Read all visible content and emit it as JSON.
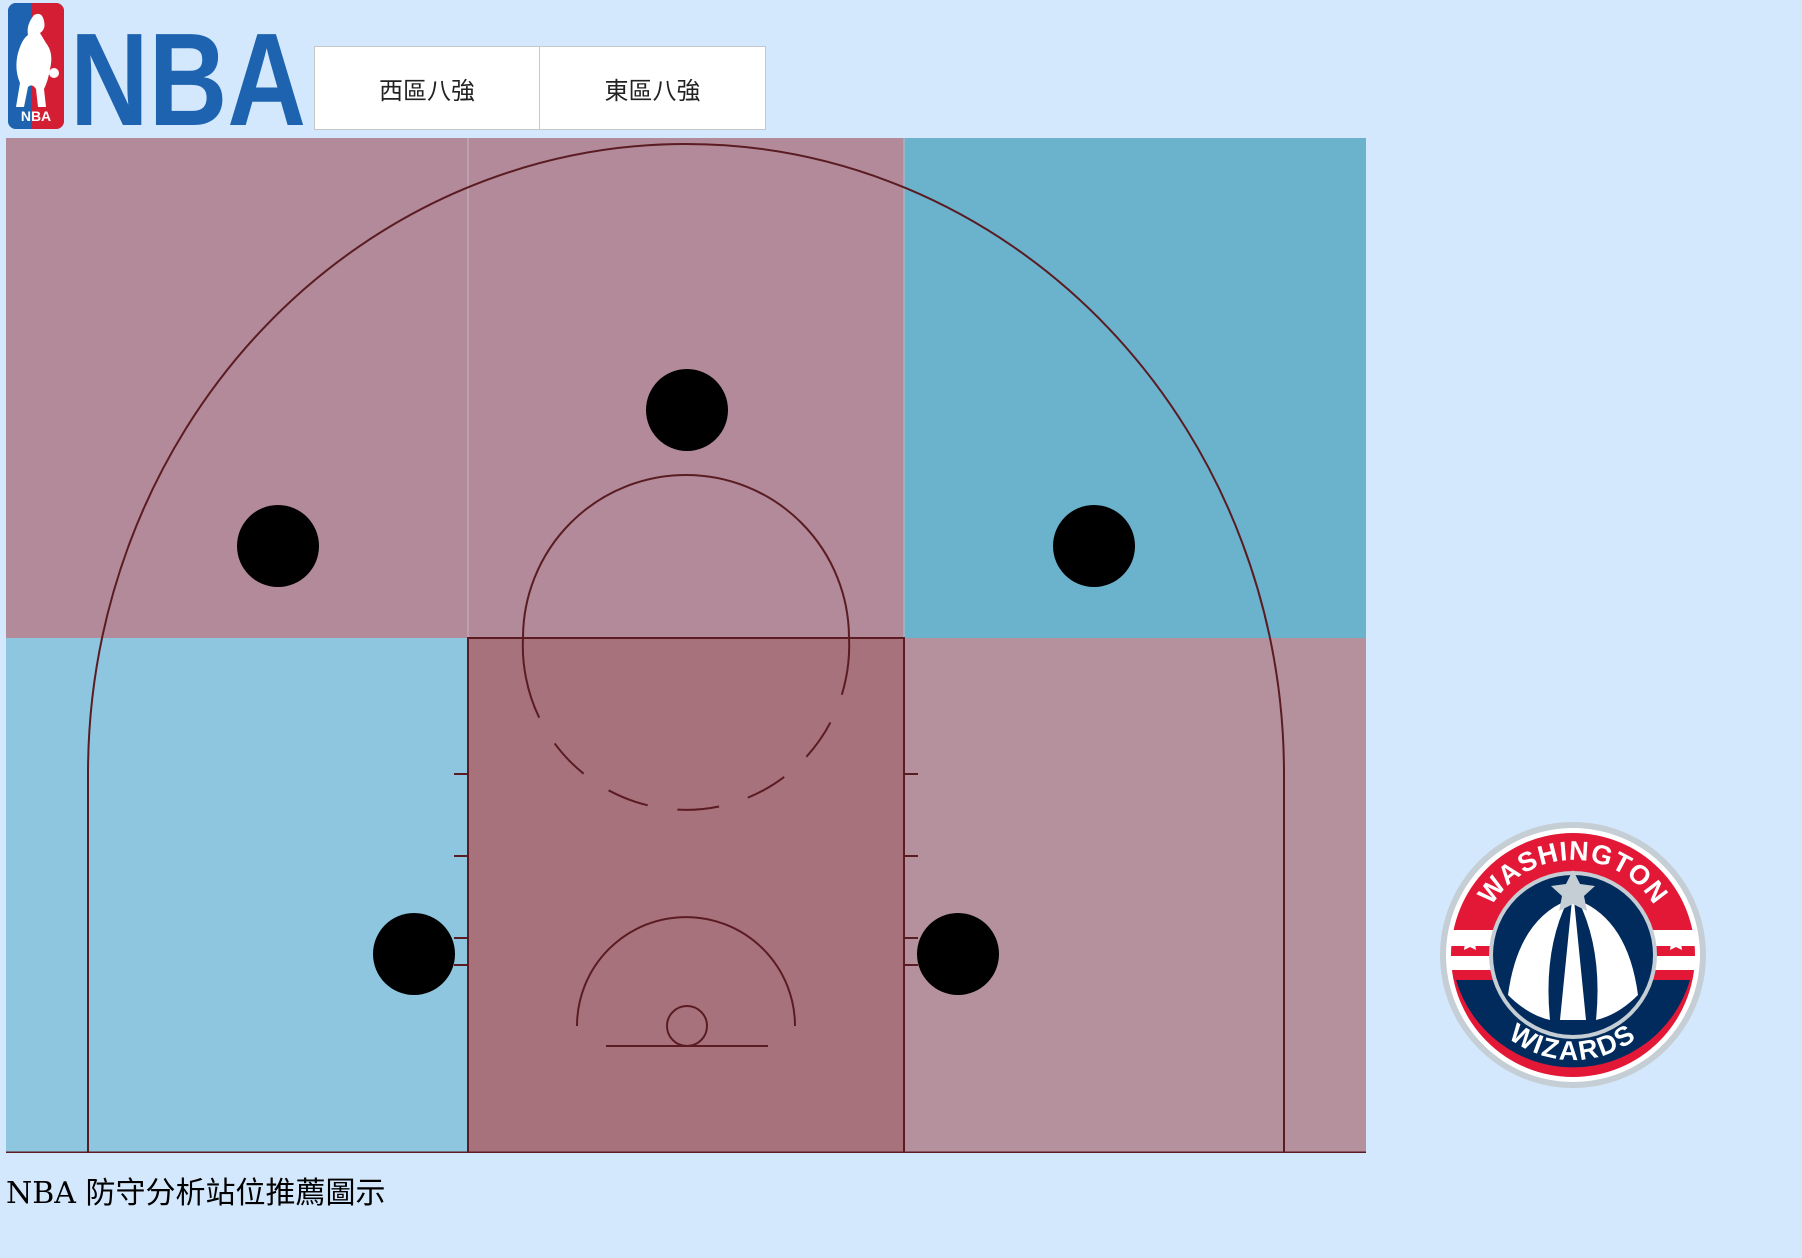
{
  "header": {
    "logo": {
      "icon": "nba-logo-icon",
      "text": "NBA",
      "badge_text": "NBA"
    },
    "tabs": [
      {
        "label": "西區八強"
      },
      {
        "label": "東區八強"
      }
    ]
  },
  "court": {
    "zones": [
      {
        "id": "left-wing",
        "color": "#b28a99"
      },
      {
        "id": "top",
        "color": "#b28a99"
      },
      {
        "id": "right-wing",
        "color": "#6bb3cd"
      },
      {
        "id": "left-corner",
        "color": "#8ec5df"
      },
      {
        "id": "paint",
        "color": "#a8727c"
      },
      {
        "id": "right-corner",
        "color": "#b4919d"
      }
    ],
    "line_color": "#5a1c22",
    "player_color": "#000000",
    "players": [
      "left-wing",
      "top",
      "right-wing",
      "left-block",
      "right-block"
    ]
  },
  "caption": "NBA 防守分析站位推薦圖示",
  "team_logo": {
    "icon": "washington-wizards-logo-icon",
    "top_text": "WASHINGTON",
    "bottom_text": "WIZARDS",
    "colors": {
      "red": "#e31837",
      "navy": "#002b5c",
      "silver": "#c4ced4"
    }
  }
}
